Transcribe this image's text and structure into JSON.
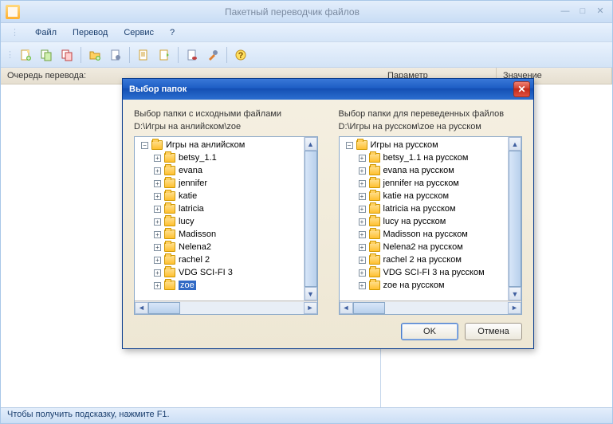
{
  "window": {
    "title": "Пакетный переводчик файлов",
    "status": "Чтобы получить подсказку, нажмите F1."
  },
  "menu": {
    "file": "Файл",
    "translate": "Перевод",
    "service": "Сервис",
    "help": "?"
  },
  "panels": {
    "queue_label": "Очередь перевода:",
    "param_header": "Параметр",
    "value_header": "Значение"
  },
  "toolbar_icons": [
    "new-doc-icon",
    "copy-icon",
    "paste-icon",
    "folder-icon",
    "settings-doc-icon",
    "page-icon",
    "page-arrow-icon",
    "doc-db-icon",
    "tools-icon",
    "help-icon"
  ],
  "dialog": {
    "title": "Выбор папок",
    "left_label": "Выбор папки с исходными файлами",
    "left_path": "D:\\Игры на анлийском\\zoe",
    "right_label": "Выбор папки для переведенных файлов",
    "right_path": "D:\\Игры на русском\\zoe на русском",
    "left_root": "Игры на анлийском",
    "left_items": [
      "betsy_1.1",
      "evana",
      "jennifer",
      "katie",
      "latricia",
      "lucy",
      "Madisson",
      "Nelena2",
      "rachel 2",
      "VDG SCI-FI 3",
      "zoe"
    ],
    "left_selected": "zoe",
    "right_root": "Игры на русском",
    "right_items": [
      "betsy_1.1 на русском",
      "evana на русском",
      "jennifer на русском",
      "katie на русском",
      "latricia на русском",
      "lucy на русском",
      "Madisson на русском",
      "Nelena2 на русском",
      "rachel 2 на русском",
      "VDG SCI-FI 3 на русском",
      "zoe на русском"
    ],
    "ok": "OK",
    "cancel": "Отмена"
  }
}
